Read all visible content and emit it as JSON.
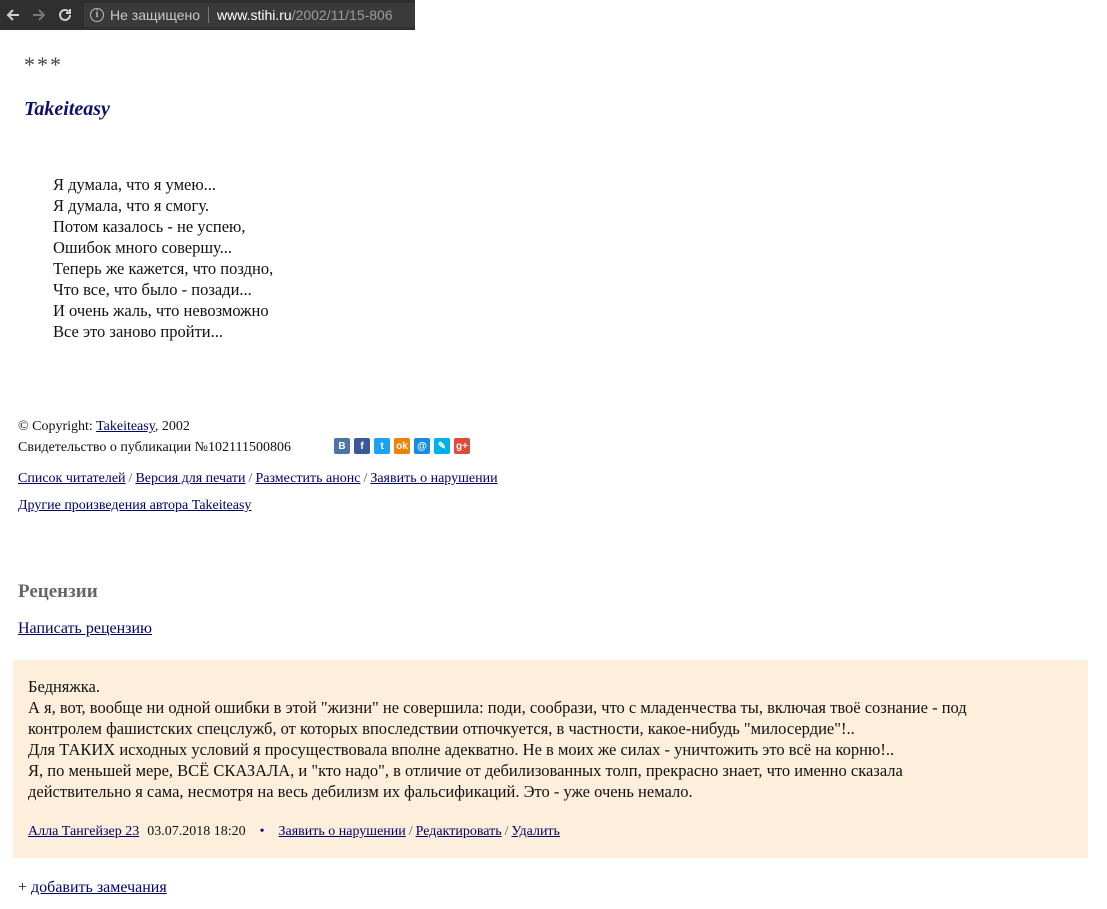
{
  "browser": {
    "security_label": "Не защищено",
    "url_domain": "www.stihi.ru",
    "url_path": "/2002/11/15-806"
  },
  "poem": {
    "stars": "***",
    "author": "Takeiteasy",
    "lines": [
      "Я думала, что я умею...",
      "Я думала, что я смогу.",
      "Потом казалось - не успею,",
      "Ошибок много совершу...",
      "Теперь же кажется, что поздно,",
      "Что все, что было - позади...",
      "И очень жаль, что невозможно",
      "Все это заново пройти..."
    ]
  },
  "copyright": {
    "prefix": "© Copyright: ",
    "author_link": "Takeiteasy",
    "year": ", 2002",
    "certificate": "Свидетельство о публикации №102111500806"
  },
  "share_buttons": [
    {
      "name": "vk",
      "glyph": "B",
      "color": "#4c75a3"
    },
    {
      "name": "facebook",
      "glyph": "f",
      "color": "#3b5998"
    },
    {
      "name": "twitter",
      "glyph": "t",
      "color": "#1da1f2"
    },
    {
      "name": "odnoklassniki",
      "glyph": "ok",
      "color": "#ee8208"
    },
    {
      "name": "mailru",
      "glyph": "@",
      "color": "#168de2"
    },
    {
      "name": "livejournal",
      "glyph": "✎",
      "color": "#00b0ea"
    },
    {
      "name": "googleplus",
      "glyph": "g+",
      "color": "#dd4b39"
    }
  ],
  "links": {
    "readers": "Список читателей",
    "print": "Версия для печати",
    "announce": "Разместить анонс",
    "report": "Заявить о нарушении",
    "sep": "/",
    "other_works": "Другие произведения автора Takeiteasy"
  },
  "reviews": {
    "heading": "Рецензии",
    "write": "Написать рецензию",
    "items": [
      {
        "text_lines": [
          "Бедняжка.",
          "А я, вот, вообще ни одной ошибки в этой \"жизни\" не совершила: поди, сообрази, что с младенчества ты, включая твоё сознание - под",
          "контролем фашистских спецслужб, от которых впоследствии отпочкуется, в частности, какое-нибудь \"милосердие\"!..",
          "Для ТАКИХ исходных условий я просуществовала вполне адекватно. Не в моих же силах - уничтожить это всё на корню!..",
          "Я, по меньшей мере, ВСЁ СКАЗАЛА, и \"кто надо\", в отличие от дебилизованных толп, прекрасно знает, что именно сказала",
          "действительно я сама, несмотря на весь дебилизм их фальсификаций. Это - уже очень немало."
        ],
        "author": "Алла Тангейзер 23",
        "date": "03.07.2018 18:20",
        "bullet": "•",
        "report": "Заявить о нарушении",
        "edit": "Редактировать",
        "delete": "Удалить"
      }
    ],
    "add_prefix": "+ ",
    "add_remarks": "добавить замечания"
  }
}
